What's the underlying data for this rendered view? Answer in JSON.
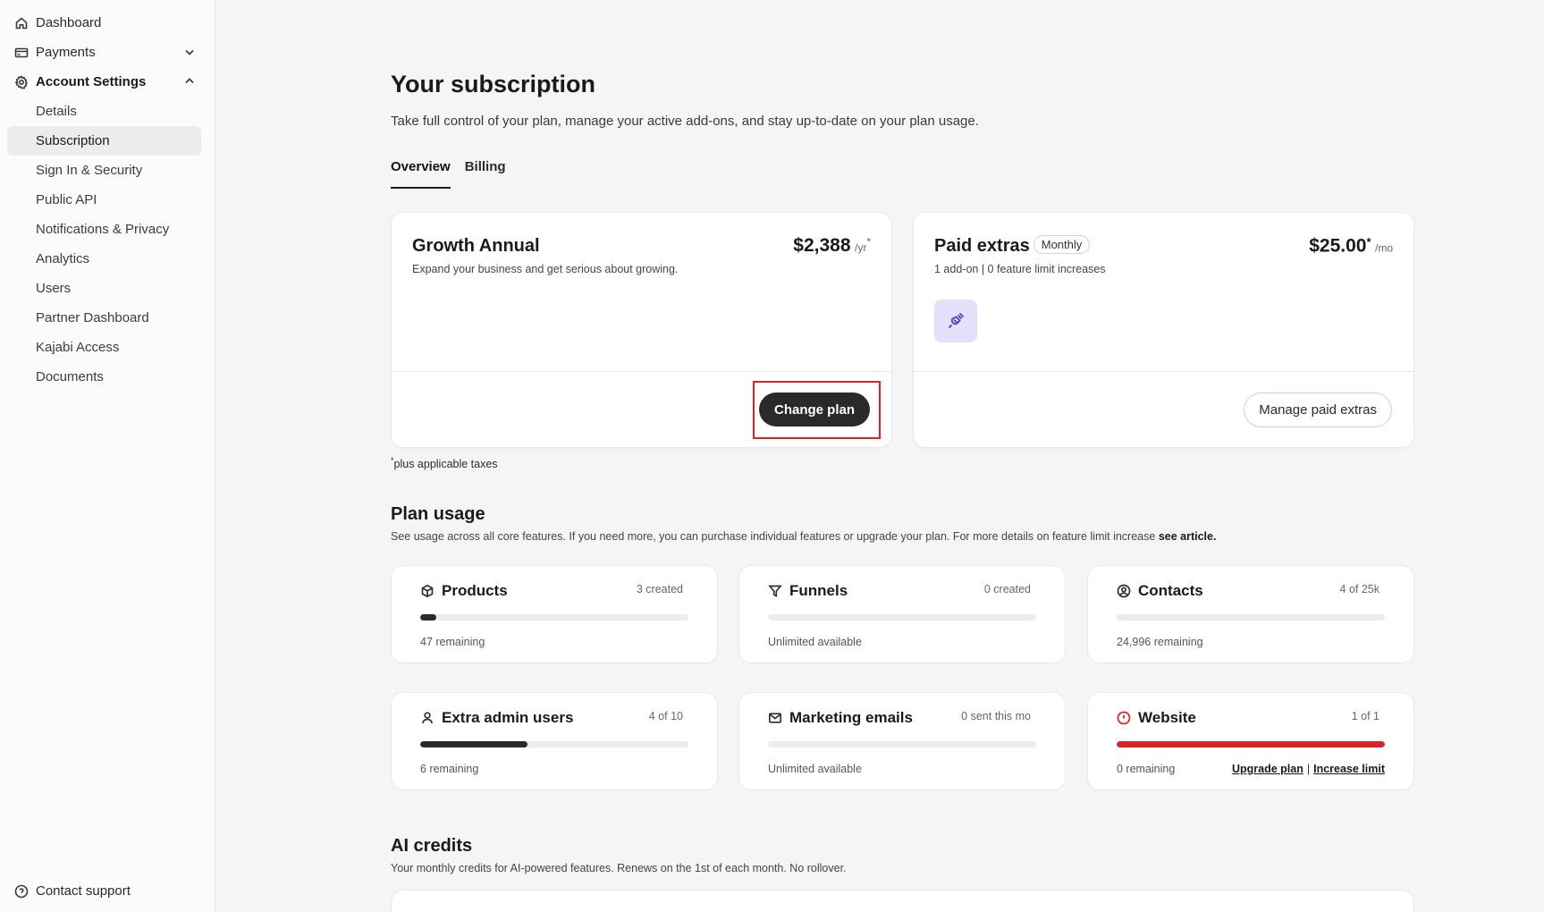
{
  "sidebar": {
    "dashboard": "Dashboard",
    "payments": "Payments",
    "account_settings": "Account Settings",
    "sub_items": [
      "Details",
      "Subscription",
      "Sign In & Security",
      "Public API",
      "Notifications & Privacy",
      "Analytics",
      "Users",
      "Partner Dashboard",
      "Kajabi Access",
      "Documents"
    ],
    "active_item": "Subscription",
    "contact_support": "Contact support"
  },
  "page": {
    "title": "Your subscription",
    "subtitle": "Take full control of your plan, manage your active add-ons, and stay up-to-date on your plan usage."
  },
  "tabs": [
    {
      "label": "Overview",
      "active": true
    },
    {
      "label": "Billing",
      "active": false
    }
  ],
  "plan": {
    "name": "Growth Annual",
    "description": "Expand your business and get serious about growing.",
    "price": "$2,388",
    "period": "/yr",
    "asterisk": "*",
    "button": "Change plan"
  },
  "extras": {
    "title": "Paid extras",
    "badge": "Monthly",
    "description": "1 add-on | 0 feature limit increases",
    "price": "$25.00",
    "asterisk": "*",
    "period": "/mo",
    "button": "Manage paid extras",
    "icon": "plug-icon"
  },
  "tax_note": {
    "asterisk": "*",
    "text": "plus applicable taxes"
  },
  "plan_usage": {
    "title": "Plan usage",
    "subtitle": "See usage across all core features. If you need more, you can purchase individual features or upgrade your plan. For more details on feature limit increase ",
    "link": "see article.",
    "items": [
      {
        "name": "Products",
        "count": "3 created",
        "footer": "47 remaining",
        "fill": 0.06,
        "icon": "box-icon"
      },
      {
        "name": "Funnels",
        "count": "0 created",
        "footer": "Unlimited available",
        "fill": 0,
        "icon": "funnel-icon"
      },
      {
        "name": "Contacts",
        "count": "4 of 25k",
        "footer": "24,996 remaining",
        "fill": 0,
        "icon": "contact-icon"
      },
      {
        "name": "Extra admin users",
        "count": "4 of 10",
        "footer": "6 remaining",
        "fill": 0.4,
        "icon": "user-icon"
      },
      {
        "name": "Marketing emails",
        "count": "0 sent this mo",
        "footer": "Unlimited available",
        "fill": 0,
        "icon": "mail-icon"
      },
      {
        "name": "Website",
        "count": "1 of 1",
        "footer": "0 remaining",
        "fill": 1.0,
        "icon": "alert-icon"
      }
    ],
    "website_links": {
      "upgrade": "Upgrade plan",
      "separator": "|",
      "increase": "Increase limit"
    }
  },
  "ai_credits": {
    "title": "AI credits",
    "subtitle": "Your monthly credits for AI-powered features. Renews on the 1st of each month. No rollover."
  },
  "colors": {
    "accent_dark": "#2b2a28",
    "danger": "#d9232b",
    "highlight_box": "#e0211f",
    "extras_icon_bg": "#e2e0fb"
  }
}
